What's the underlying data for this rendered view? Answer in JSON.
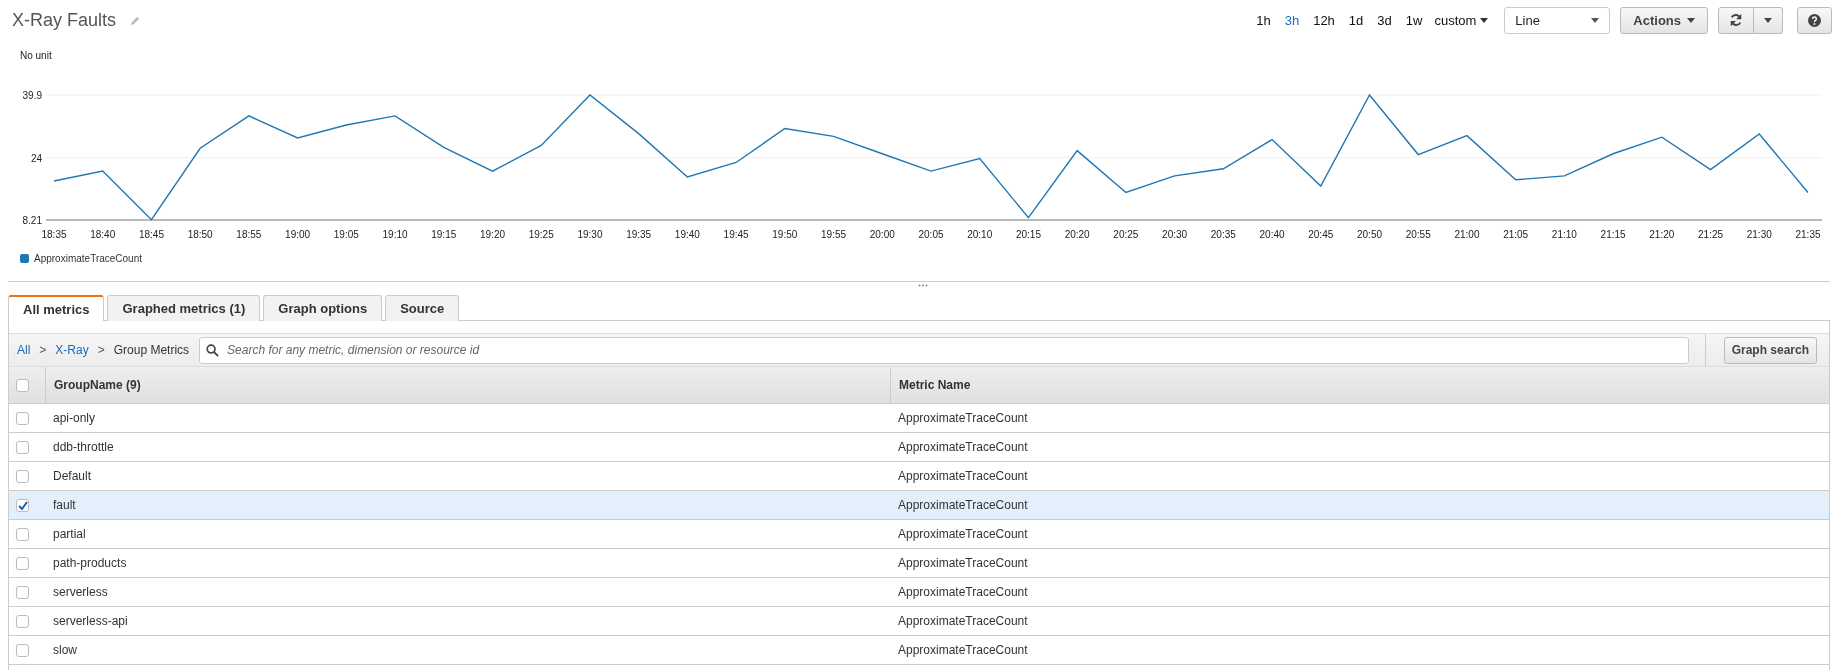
{
  "dashboard": {
    "title": "X-Ray Faults"
  },
  "time_ranges": [
    {
      "label": "1h",
      "selected": false
    },
    {
      "label": "3h",
      "selected": true
    },
    {
      "label": "12h",
      "selected": false
    },
    {
      "label": "1d",
      "selected": false
    },
    {
      "label": "3d",
      "selected": false
    },
    {
      "label": "1w",
      "selected": false
    }
  ],
  "custom_range": {
    "label": "custom"
  },
  "view_select": {
    "value": "Line"
  },
  "actions_button": {
    "label": "Actions"
  },
  "graph": {
    "unit_label": "No unit",
    "chart_data": {
      "type": "line",
      "categories": [
        "18:35",
        "18:40",
        "18:45",
        "18:50",
        "18:55",
        "19:00",
        "19:05",
        "19:10",
        "19:15",
        "19:20",
        "19:25",
        "19:30",
        "19:35",
        "19:40",
        "19:45",
        "19:50",
        "19:55",
        "20:00",
        "20:05",
        "20:10",
        "20:15",
        "20:20",
        "20:25",
        "20:30",
        "20:35",
        "20:40",
        "20:45",
        "20:50",
        "20:55",
        "21:00",
        "21:05",
        "21:10",
        "21:15",
        "21:20",
        "21:25",
        "21:30",
        "21:35"
      ],
      "series": [
        {
          "name": "ApproximateTraceCount",
          "color": "#1f77b4",
          "values": [
            18.1,
            20.6,
            8.3,
            26.4,
            34.6,
            29.0,
            32.3,
            34.6,
            26.6,
            20.6,
            27.1,
            39.9,
            30.1,
            19.1,
            22.8,
            31.4,
            29.4,
            25.0,
            20.6,
            23.8,
            8.8,
            25.8,
            15.2,
            19.4,
            21.2,
            28.6,
            16.8,
            39.9,
            24.8,
            29.6,
            18.4,
            19.4,
            25.0,
            29.2,
            21.0,
            30.0,
            15.2
          ]
        }
      ],
      "ylim": [
        8.21,
        39.9
      ],
      "yticks": [
        8.21,
        24,
        39.9
      ]
    }
  },
  "tabs": [
    {
      "label": "All metrics",
      "selected": true
    },
    {
      "label": "Graphed metrics (1)",
      "selected": false
    },
    {
      "label": "Graph options",
      "selected": false
    },
    {
      "label": "Source",
      "selected": false
    }
  ],
  "breadcrumb": [
    {
      "label": "All",
      "link": true
    },
    {
      "label": "X-Ray",
      "link": true
    },
    {
      "label": "Group Metrics",
      "link": false
    }
  ],
  "breadcrumb_separators": [
    ">",
    ">"
  ],
  "search": {
    "placeholder": "Search for any metric, dimension or resource id"
  },
  "graph_search_button": {
    "label": "Graph search"
  },
  "table": {
    "select_all": {
      "checked": false
    },
    "columns": [
      "GroupName (9)",
      "Metric Name"
    ],
    "rows": [
      {
        "group": "api-only",
        "metric": "ApproximateTraceCount",
        "checked": false
      },
      {
        "group": "ddb-throttle",
        "metric": "ApproximateTraceCount",
        "checked": false
      },
      {
        "group": "Default",
        "metric": "ApproximateTraceCount",
        "checked": false
      },
      {
        "group": "fault",
        "metric": "ApproximateTraceCount",
        "checked": true
      },
      {
        "group": "partial",
        "metric": "ApproximateTraceCount",
        "checked": false
      },
      {
        "group": "path-products",
        "metric": "ApproximateTraceCount",
        "checked": false
      },
      {
        "group": "serverless",
        "metric": "ApproximateTraceCount",
        "checked": false
      },
      {
        "group": "serverless-api",
        "metric": "ApproximateTraceCount",
        "checked": false
      },
      {
        "group": "slow",
        "metric": "ApproximateTraceCount",
        "checked": false
      }
    ]
  }
}
